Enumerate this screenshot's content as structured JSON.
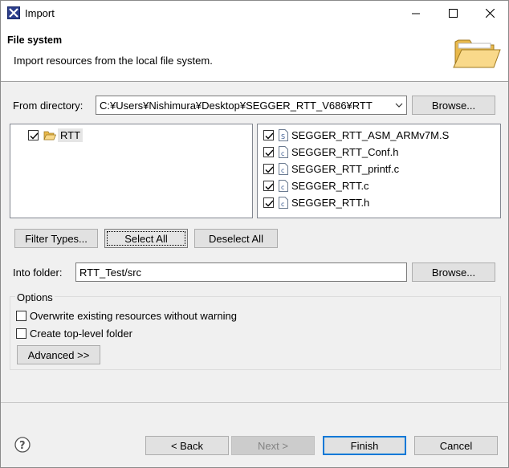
{
  "window": {
    "title": "Import"
  },
  "banner": {
    "title": "File system",
    "description": "Import resources from the local file system."
  },
  "from_directory": {
    "label": "From directory:",
    "value": "C:¥Users¥Nishimura¥Desktop¥SEGGER_RTT_V686¥RTT",
    "browse_label": "Browse..."
  },
  "folder_tree": {
    "items": [
      {
        "label": "RTT",
        "checked": true
      }
    ]
  },
  "file_list": {
    "items": [
      {
        "label": "SEGGER_RTT_ASM_ARMv7M.S",
        "checked": true,
        "icon": "s-file-icon"
      },
      {
        "label": "SEGGER_RTT_Conf.h",
        "checked": true,
        "icon": "c-file-icon"
      },
      {
        "label": "SEGGER_RTT_printf.c",
        "checked": true,
        "icon": "c-file-icon"
      },
      {
        "label": "SEGGER_RTT.c",
        "checked": true,
        "icon": "c-file-icon"
      },
      {
        "label": "SEGGER_RTT.h",
        "checked": true,
        "icon": "c-file-icon"
      }
    ]
  },
  "selection_buttons": {
    "filter_types": "Filter Types...",
    "select_all": "Select All",
    "deselect_all": "Deselect All"
  },
  "into_folder": {
    "label": "Into folder:",
    "value": "RTT_Test/src",
    "browse_label": "Browse..."
  },
  "options": {
    "title": "Options",
    "overwrite": {
      "label": "Overwrite existing resources without warning",
      "checked": false
    },
    "create_top_level": {
      "label": "Create top-level folder",
      "checked": false
    },
    "advanced_label": "Advanced >>"
  },
  "footer": {
    "back_label": "< Back",
    "next_label": "Next >",
    "finish_label": "Finish",
    "cancel_label": "Cancel"
  },
  "colors": {
    "accent": "#0078d7",
    "folder": "#f5c969"
  }
}
